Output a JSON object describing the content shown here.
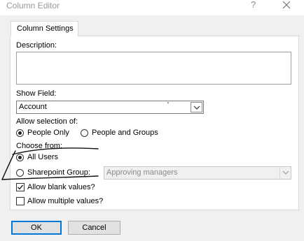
{
  "window": {
    "title": "Column Editor",
    "help_glyph": "?"
  },
  "tabs": [
    {
      "label": "Column Settings",
      "selected": true
    }
  ],
  "description": {
    "label": "Description:",
    "value": ""
  },
  "show_field": {
    "label": "Show Field:",
    "value": "Account",
    "marker": "'"
  },
  "allow_selection": {
    "label": "Allow selection of:",
    "options": [
      {
        "label": "People Only",
        "checked": true
      },
      {
        "label": "People and Groups",
        "checked": false
      }
    ]
  },
  "choose_from": {
    "label": "Choose from:",
    "options": [
      {
        "label": "All Users",
        "checked": true
      },
      {
        "label": "Sharepoint Group:",
        "checked": false
      }
    ],
    "group_dropdown": {
      "value": "Approving managers",
      "enabled": false
    }
  },
  "checkboxes": [
    {
      "label": "Allow blank values?",
      "checked": true
    },
    {
      "label": "Allow multiple values?",
      "checked": false
    }
  ],
  "buttons": {
    "ok": "OK",
    "cancel": "Cancel"
  },
  "colors": {
    "dialog_bg": "#f0f0f0",
    "focus_accent": "#0078d7",
    "title_text": "#999999"
  },
  "icons": [
    "help-icon",
    "close-icon",
    "chevron-down-icon",
    "checkmark-icon"
  ]
}
